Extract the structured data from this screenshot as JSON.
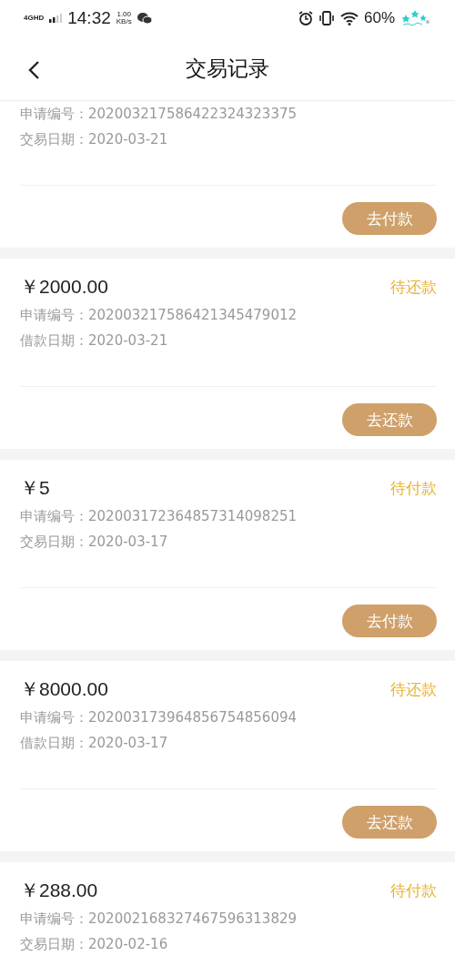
{
  "status_bar": {
    "network": "4GHD",
    "time": "14:32",
    "speed_value": "1.00",
    "speed_unit": "KB/s",
    "battery": "60%"
  },
  "header": {
    "title": "交易记录"
  },
  "records": [
    {
      "lines": [
        {
          "label": "申请编号：",
          "value": "202003217586422324323375"
        },
        {
          "label": "交易日期：",
          "value": "2020-03-21"
        }
      ],
      "action": "去付款"
    },
    {
      "amount": "￥2000.00",
      "status": "待还款",
      "lines": [
        {
          "label": "申请编号：",
          "value": "202003217586421345479012"
        },
        {
          "label": "借款日期：",
          "value": "2020-03-21"
        }
      ],
      "action": "去还款"
    },
    {
      "amount": "￥5",
      "status": "待付款",
      "lines": [
        {
          "label": "申请编号：",
          "value": "202003172364857314098251"
        },
        {
          "label": "交易日期：",
          "value": "2020-03-17"
        }
      ],
      "action": "去付款"
    },
    {
      "amount": "￥8000.00",
      "status": "待还款",
      "lines": [
        {
          "label": "申请编号：",
          "value": "202003173964856754856094"
        },
        {
          "label": "借款日期：",
          "value": "2020-03-17"
        }
      ],
      "action": "去还款"
    },
    {
      "amount": "￥288.00",
      "status": "待付款",
      "lines": [
        {
          "label": "申请编号：",
          "value": "202002168327467596313829"
        },
        {
          "label": "交易日期：",
          "value": "2020-02-16"
        }
      ]
    }
  ]
}
